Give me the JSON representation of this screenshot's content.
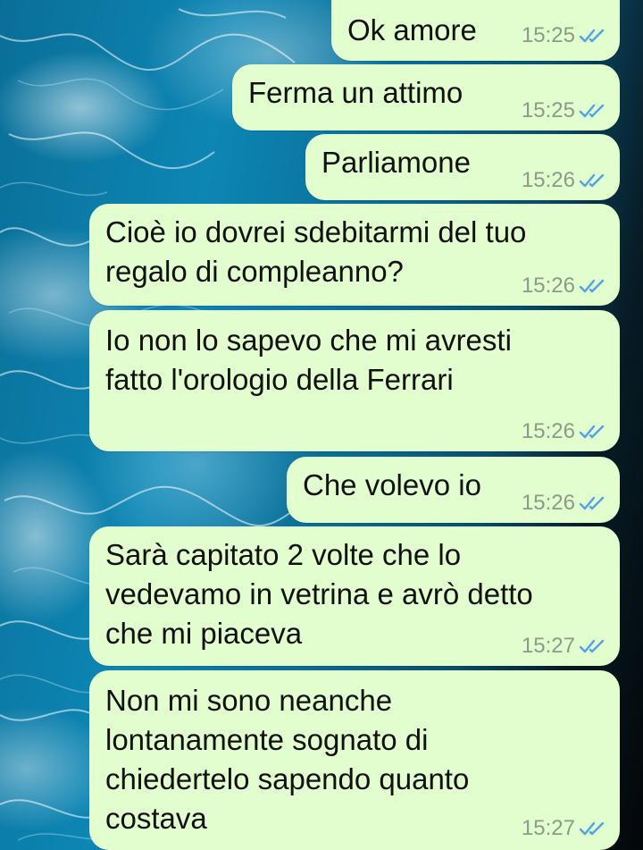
{
  "chat": {
    "messages": [
      {
        "text": "Ok amore",
        "time": "15:25",
        "status": "read"
      },
      {
        "text": "Ferma un attimo",
        "time": "15:25",
        "status": "read"
      },
      {
        "text": "Parliamone",
        "time": "15:26",
        "status": "read"
      },
      {
        "text": "Cioè io dovrei sdebitarmi del tuo\nregalo di compleanno?",
        "time": "15:26",
        "status": "read"
      },
      {
        "text": "Io non lo sapevo che mi avresti\nfatto l'orologio della Ferrari",
        "time": "15:26",
        "status": "read"
      },
      {
        "text": "Che volevo io",
        "time": "15:26",
        "status": "read"
      },
      {
        "text": "Sarà capitato 2 volte che lo\nvedevamo in vetrina e avrò detto\nche mi piaceva",
        "time": "15:27",
        "status": "read"
      },
      {
        "text": "Non mi sono neanche\nlontanamente sognato di\nchiedertelo sapendo quanto\ncostava",
        "time": "15:27",
        "status": "read"
      }
    ]
  },
  "colors": {
    "bubble_outgoing": "#e2fdce",
    "read_ticks": "#4fa3e6",
    "timestamp": "#8d9a8a",
    "wallpaper": "#0a7aa6"
  },
  "icons": {
    "read_receipt": "double-check-icon"
  }
}
